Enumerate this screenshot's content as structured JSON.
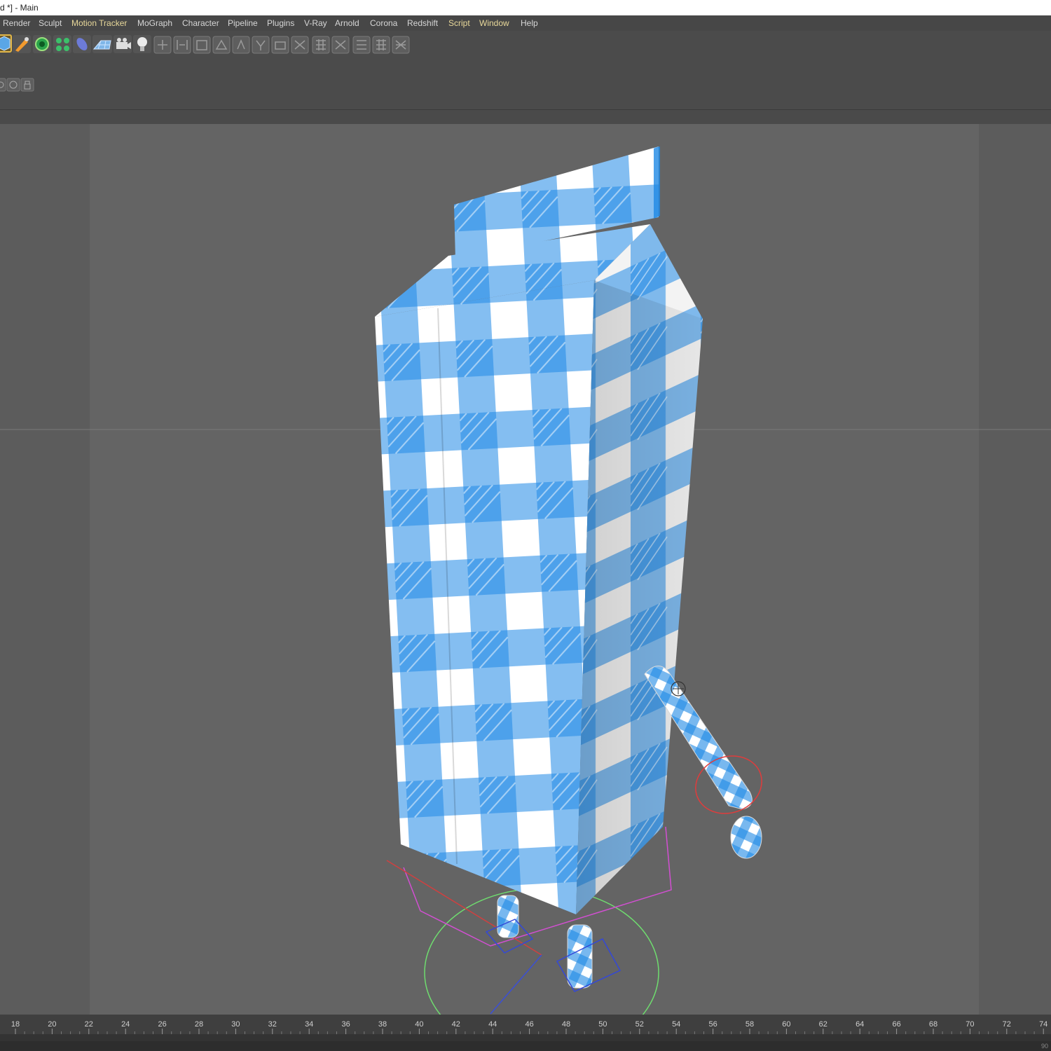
{
  "window": {
    "title": "d *] - Main"
  },
  "menu": {
    "items": [
      {
        "label": "Render",
        "highlight": false
      },
      {
        "label": "Sculpt",
        "highlight": false
      },
      {
        "label": "Motion Tracker",
        "highlight": true
      },
      {
        "label": "MoGraph",
        "highlight": false
      },
      {
        "label": "Character",
        "highlight": false
      },
      {
        "label": "Pipeline",
        "highlight": false
      },
      {
        "label": "Plugins",
        "highlight": false
      },
      {
        "label": "V-Ray",
        "highlight": false
      },
      {
        "label": "Arnold",
        "highlight": false
      },
      {
        "label": "Corona",
        "highlight": false
      },
      {
        "label": "Redshift",
        "highlight": false
      },
      {
        "label": "Script",
        "highlight": true
      },
      {
        "label": "Window",
        "highlight": true
      },
      {
        "label": "Help",
        "highlight": false
      }
    ]
  },
  "toolbar": {
    "icons": [
      "cube-icon",
      "pen-icon",
      "subdivision-icon",
      "cloner-icon",
      "deformer-icon",
      "floor-icon",
      "camera-icon",
      "light-icon",
      "align-icon",
      "mirror-icon",
      "polygon-icon",
      "extrude-icon",
      "bevel-icon",
      "knife-icon",
      "bridge-icon",
      "weld-icon",
      "grid-icon",
      "snap-icon",
      "array-icon",
      "matrix-icon",
      "random-icon"
    ],
    "sub_icons": [
      "snap-mode-icon",
      "soft-selection-icon",
      "lock-icon"
    ]
  },
  "viewport": {
    "object": "milk-carton-character",
    "texture_colors": {
      "primary": "#1e88e5",
      "secondary": "#ffffff"
    }
  },
  "timeline": {
    "ticks": [
      "18",
      "20",
      "22",
      "24",
      "26",
      "28",
      "30",
      "32",
      "34",
      "36",
      "38",
      "40",
      "42",
      "44",
      "46",
      "48",
      "50",
      "52",
      "54",
      "56",
      "58",
      "60",
      "62",
      "64",
      "66",
      "68",
      "70",
      "72",
      "74"
    ],
    "end_label": "90"
  },
  "colors": {
    "menu_highlight": "#e8d89a",
    "viewport_bg": "#646464",
    "ui_dark": "#474747"
  }
}
